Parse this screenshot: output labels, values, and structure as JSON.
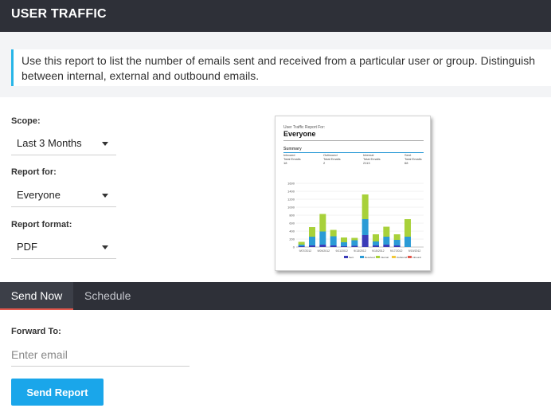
{
  "header": {
    "title": "USER TRAFFIC"
  },
  "info": {
    "text": "Use this report to list the number of emails sent and received from a particular user or group. Distinguish between internal, external and outbound emails."
  },
  "scope": {
    "label": "Scope:",
    "value": "Last 3 Months"
  },
  "report_for": {
    "label": "Report for:",
    "value": "Everyone"
  },
  "report_format": {
    "label": "Report format:",
    "value": "PDF"
  },
  "preview": {
    "subtitle": "User Traffic Report For:",
    "title": "Everyone",
    "summary_label": "Summary",
    "summary": [
      {
        "name": "Inbound",
        "metric": "Total Emails",
        "value": "18"
      },
      {
        "name": "Outbound",
        "metric": "Total Emails",
        "value": "2"
      },
      {
        "name": "Internal",
        "metric": "Total Emails",
        "value": "2113"
      },
      {
        "name": "Sent",
        "metric": "Total Emails",
        "value": "68"
      }
    ],
    "colors": {
      "sent": "#3b3bb8",
      "received": "#2b9bd6",
      "internal": "#a8d13a",
      "outbound": "#f2c83a",
      "inbound": "#e2574c"
    }
  },
  "chart_data": {
    "type": "bar",
    "stacked": true,
    "ylim": [
      0,
      1600
    ],
    "yticks": [
      0,
      200,
      400,
      600,
      800,
      1000,
      1200,
      1400,
      1600
    ],
    "x_tick_labels": [
      "9/07/2012",
      "9/09/2012",
      "9/11/2012",
      "9/13/2012",
      "9/15/2012",
      "9/17/2012",
      "9/19/2012"
    ],
    "legend": [
      "Sent",
      "Received",
      "Internal",
      "Outbound",
      "Inbound"
    ],
    "series": [
      {
        "name": "Sent",
        "values": [
          20,
          40,
          60,
          40,
          20,
          30,
          300,
          40,
          60,
          40,
          0,
          0
        ]
      },
      {
        "name": "Received",
        "values": [
          40,
          220,
          330,
          230,
          100,
          140,
          400,
          100,
          200,
          140,
          260,
          0
        ]
      },
      {
        "name": "Internal",
        "values": [
          70,
          240,
          440,
          160,
          120,
          60,
          620,
          180,
          250,
          140,
          440,
          0
        ]
      }
    ]
  },
  "tabs": {
    "send_now": "Send Now",
    "schedule": "Schedule"
  },
  "forward": {
    "label": "Forward To:",
    "placeholder": "Enter email"
  },
  "actions": {
    "send_report": "Send Report"
  }
}
